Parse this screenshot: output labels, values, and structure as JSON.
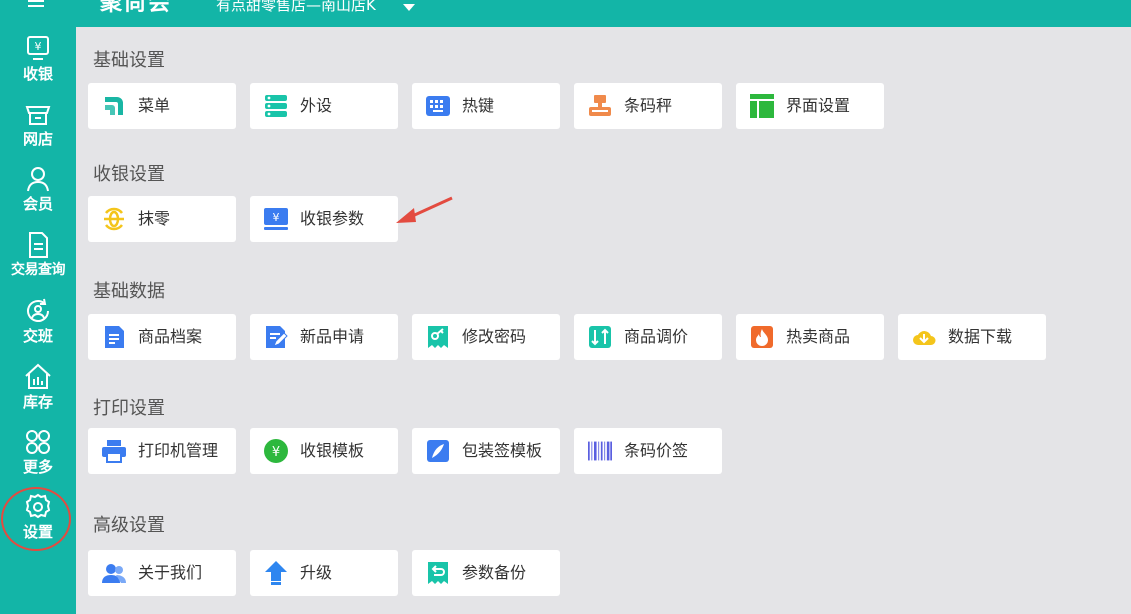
{
  "topbar": {
    "logo": "聚尚会",
    "store": "有点甜零售店—南山店K"
  },
  "sidebar": {
    "items": [
      {
        "label": "收银",
        "icon": "cashier-icon"
      },
      {
        "label": "网店",
        "icon": "shop-icon"
      },
      {
        "label": "会员",
        "icon": "member-icon"
      },
      {
        "label": "交易查询",
        "icon": "transaction-query-icon"
      },
      {
        "label": "交班",
        "icon": "shift-handover-icon"
      },
      {
        "label": "库存",
        "icon": "inventory-icon"
      },
      {
        "label": "更多",
        "icon": "more-icon"
      },
      {
        "label": "设置",
        "icon": "settings-icon",
        "active": true
      }
    ]
  },
  "sections": [
    {
      "title": "基础设置",
      "tiles": [
        {
          "label": "菜单",
          "icon": "menu-icon",
          "color": "#19b6a4"
        },
        {
          "label": "外设",
          "icon": "peripheral-icon",
          "color": "#19c4a9"
        },
        {
          "label": "热键",
          "icon": "hotkey-icon",
          "color": "#3b7cf0"
        },
        {
          "label": "条码秤",
          "icon": "barcode-scale-icon",
          "color": "#f08a4b"
        },
        {
          "label": "界面设置",
          "icon": "layout-icon",
          "color": "#2db83d"
        }
      ]
    },
    {
      "title": "收银设置",
      "tiles": [
        {
          "label": "抹零",
          "icon": "round-off-icon",
          "color": "#f4c51b"
        },
        {
          "label": "收银参数",
          "icon": "cashier-params-icon",
          "color": "#3b7cf0"
        }
      ]
    },
    {
      "title": "基础数据",
      "tiles": [
        {
          "label": "商品档案",
          "icon": "product-file-icon",
          "color": "#3b7cf0"
        },
        {
          "label": "新品申请",
          "icon": "new-product-icon",
          "color": "#3b7cf0"
        },
        {
          "label": "修改密码",
          "icon": "password-icon",
          "color": "#19c4a9"
        },
        {
          "label": "商品调价",
          "icon": "price-adjust-icon",
          "color": "#19c4a9"
        },
        {
          "label": "热卖商品",
          "icon": "hot-sale-icon",
          "color": "#f06a2b"
        },
        {
          "label": "数据下载",
          "icon": "download-icon",
          "color": "#f4c51b"
        }
      ]
    },
    {
      "title": "打印设置",
      "tiles": [
        {
          "label": "打印机管理",
          "icon": "printer-icon",
          "color": "#3b7cf0"
        },
        {
          "label": "收银模板",
          "icon": "cashier-template-icon",
          "color": "#2db83d"
        },
        {
          "label": "包装签模板",
          "icon": "package-label-icon",
          "color": "#3b7cf0"
        },
        {
          "label": "条码价签",
          "icon": "barcode-label-icon",
          "color": "#5a5fe0"
        }
      ]
    },
    {
      "title": "高级设置",
      "tiles": [
        {
          "label": "关于我们",
          "icon": "about-icon",
          "color": "#3b7cf0"
        },
        {
          "label": "升级",
          "icon": "upgrade-icon",
          "color": "#2e86f0"
        },
        {
          "label": "参数备份",
          "icon": "backup-icon",
          "color": "#19c4a9"
        }
      ]
    }
  ],
  "colors": {
    "accent": "#13b5a7",
    "annotation": "#e34b40"
  }
}
